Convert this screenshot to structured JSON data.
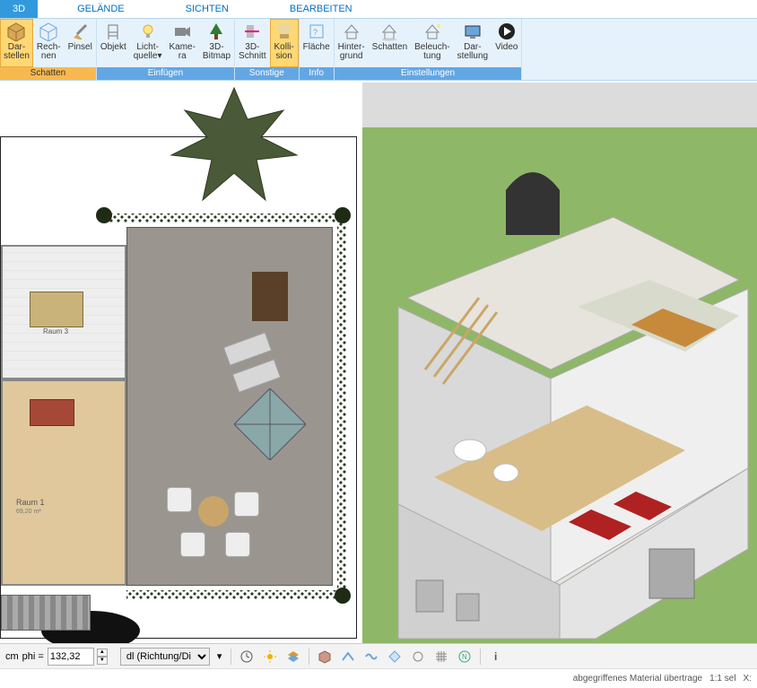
{
  "tabs": {
    "items": [
      {
        "label": "3D",
        "active": true
      },
      {
        "label": "GELÄNDE",
        "active": false
      },
      {
        "label": "SICHTEN",
        "active": false
      },
      {
        "label": "BEARBEITEN",
        "active": false
      }
    ]
  },
  "ribbon": {
    "groups": [
      {
        "label": "Schatten",
        "style": "orange",
        "buttons": [
          {
            "id": "darstellen",
            "label": "Dar-\nstellen",
            "icon": "cube-icon",
            "active": true
          },
          {
            "id": "rechnen",
            "label": "Rech-\nnen",
            "icon": "cube-ortho-icon"
          },
          {
            "id": "pinsel",
            "label": "Pinsel",
            "icon": "brush-icon"
          }
        ]
      },
      {
        "label": "Einfügen",
        "buttons": [
          {
            "id": "objekt",
            "label": "Objekt",
            "icon": "chair-icon"
          },
          {
            "id": "lichtquelle",
            "label": "Licht-\nquelle▾",
            "icon": "bulb-icon"
          },
          {
            "id": "kamera",
            "label": "Kame-\nra",
            "icon": "camera-icon"
          },
          {
            "id": "3dbitmap",
            "label": "3D-\nBitmap",
            "icon": "tree-icon"
          }
        ]
      },
      {
        "label": "Sonstige",
        "buttons": [
          {
            "id": "3dschnitt",
            "label": "3D-\nSchnitt",
            "icon": "section-icon"
          },
          {
            "id": "kollision",
            "label": "Kolli-\nsion",
            "icon": "collision-icon",
            "active": true
          }
        ]
      },
      {
        "label": "Info",
        "buttons": [
          {
            "id": "flaeche",
            "label": "Fläche",
            "icon": "area-icon"
          }
        ]
      },
      {
        "label": "Einstellungen",
        "buttons": [
          {
            "id": "hintergrund",
            "label": "Hinter-\ngrund",
            "icon": "house-bg-icon"
          },
          {
            "id": "schatten2",
            "label": "Schatten",
            "icon": "house-shadow-icon"
          },
          {
            "id": "beleuchtung",
            "label": "Beleuch-\ntung",
            "icon": "house-light-icon"
          },
          {
            "id": "darstellung",
            "label": "Dar-\nstellung",
            "icon": "screen-icon"
          },
          {
            "id": "video",
            "label": "Video",
            "icon": "play-icon"
          }
        ]
      }
    ]
  },
  "plan2d": {
    "rooms": {
      "room1_label": "Raum 1",
      "room1_area": "69,20 m²",
      "room3_label": "Raum 3"
    }
  },
  "bottom": {
    "unit": "cm",
    "phi_label": "phi =",
    "phi_value": "132,32",
    "direction_dd": "dl (Richtung/Di"
  },
  "status": {
    "text": "abgegriffenes Material übertrage",
    "scale": "1:1 sel",
    "coord_x_label": "X:"
  }
}
